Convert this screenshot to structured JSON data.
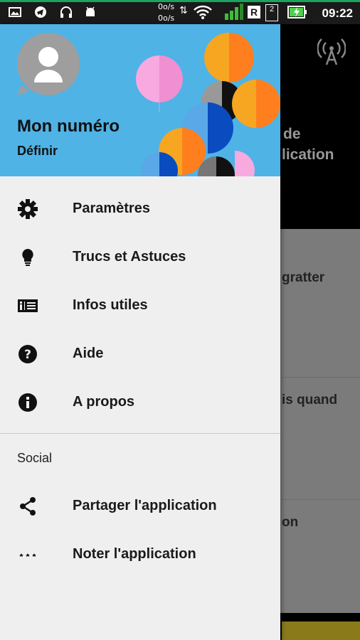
{
  "status_bar": {
    "speed_up": "0o/s",
    "speed_down": "0o/s",
    "sim1_label": "R",
    "sim2_label": "2",
    "time": "09:22"
  },
  "background_app": {
    "title_line1": "de",
    "title_line2": "lication",
    "rows": [
      "gratter",
      "is quand",
      "on"
    ]
  },
  "drawer": {
    "header": {
      "number_label": "Mon numéro",
      "define_link": "Définir"
    },
    "menu": [
      {
        "label": "Paramètres",
        "icon": "gear-icon"
      },
      {
        "label": "Trucs et Astuces",
        "icon": "lightbulb-icon"
      },
      {
        "label": "Infos utiles",
        "icon": "info-card-icon"
      },
      {
        "label": "Aide",
        "icon": "help-icon"
      },
      {
        "label": "A propos",
        "icon": "info-icon"
      }
    ],
    "social_title": "Social",
    "social": [
      {
        "label": "Partager l'application",
        "icon": "share-icon"
      },
      {
        "label": "Noter l'application",
        "icon": "stars-icon"
      }
    ]
  },
  "colors": {
    "header_bg": "#4fb3e6",
    "drawer_bg": "#efefef",
    "status_accent": "#1aa35c"
  }
}
